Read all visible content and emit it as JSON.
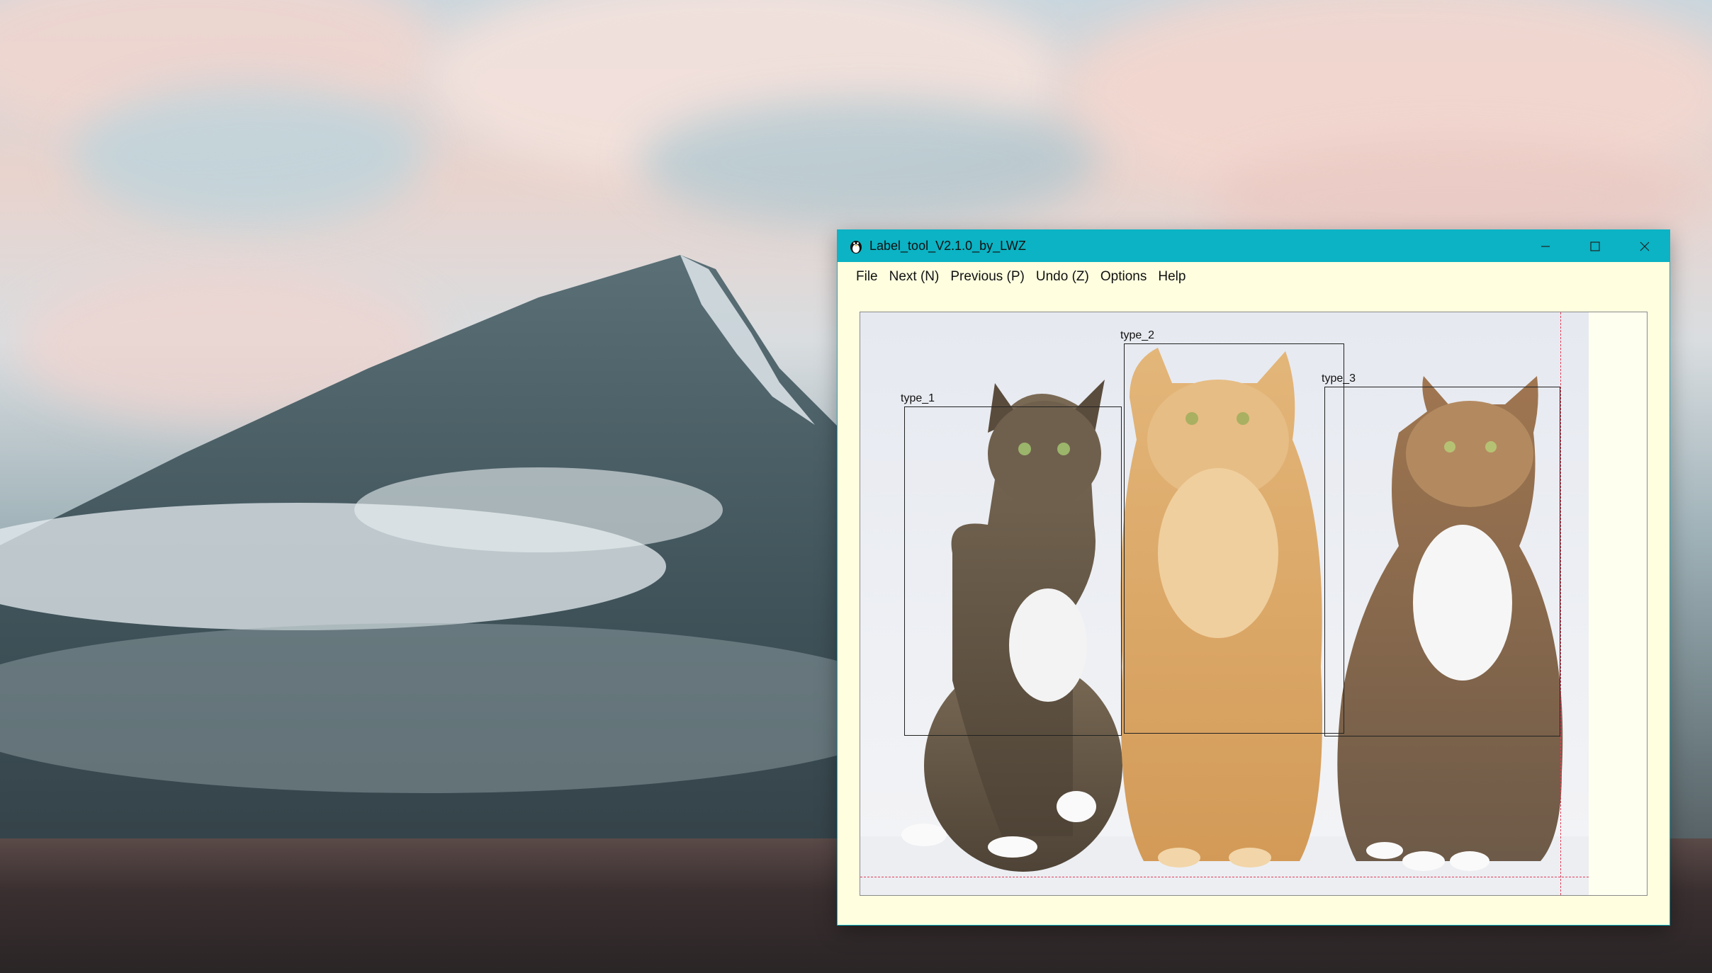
{
  "window": {
    "title": "Label_tool_V2.1.0_by_LWZ",
    "title_bar_color": "#0bb3c4",
    "background_color": "#ffffe0",
    "controls": {
      "minimize_icon": "minimize-icon",
      "maximize_icon": "maximize-icon",
      "close_icon": "close-icon"
    }
  },
  "menu": {
    "items": [
      {
        "label": "File"
      },
      {
        "label": "Next (N)"
      },
      {
        "label": "Previous (P)"
      },
      {
        "label": "Undo (Z)"
      },
      {
        "label": "Options"
      },
      {
        "label": "Help"
      }
    ]
  },
  "annotations": [
    {
      "label": "type_1",
      "subject": "tabby cat"
    },
    {
      "label": "type_2",
      "subject": "orange long-haired cat"
    },
    {
      "label": "type_3",
      "subject": "calico tabby cat"
    }
  ],
  "crosshair_color": "#e0405a"
}
